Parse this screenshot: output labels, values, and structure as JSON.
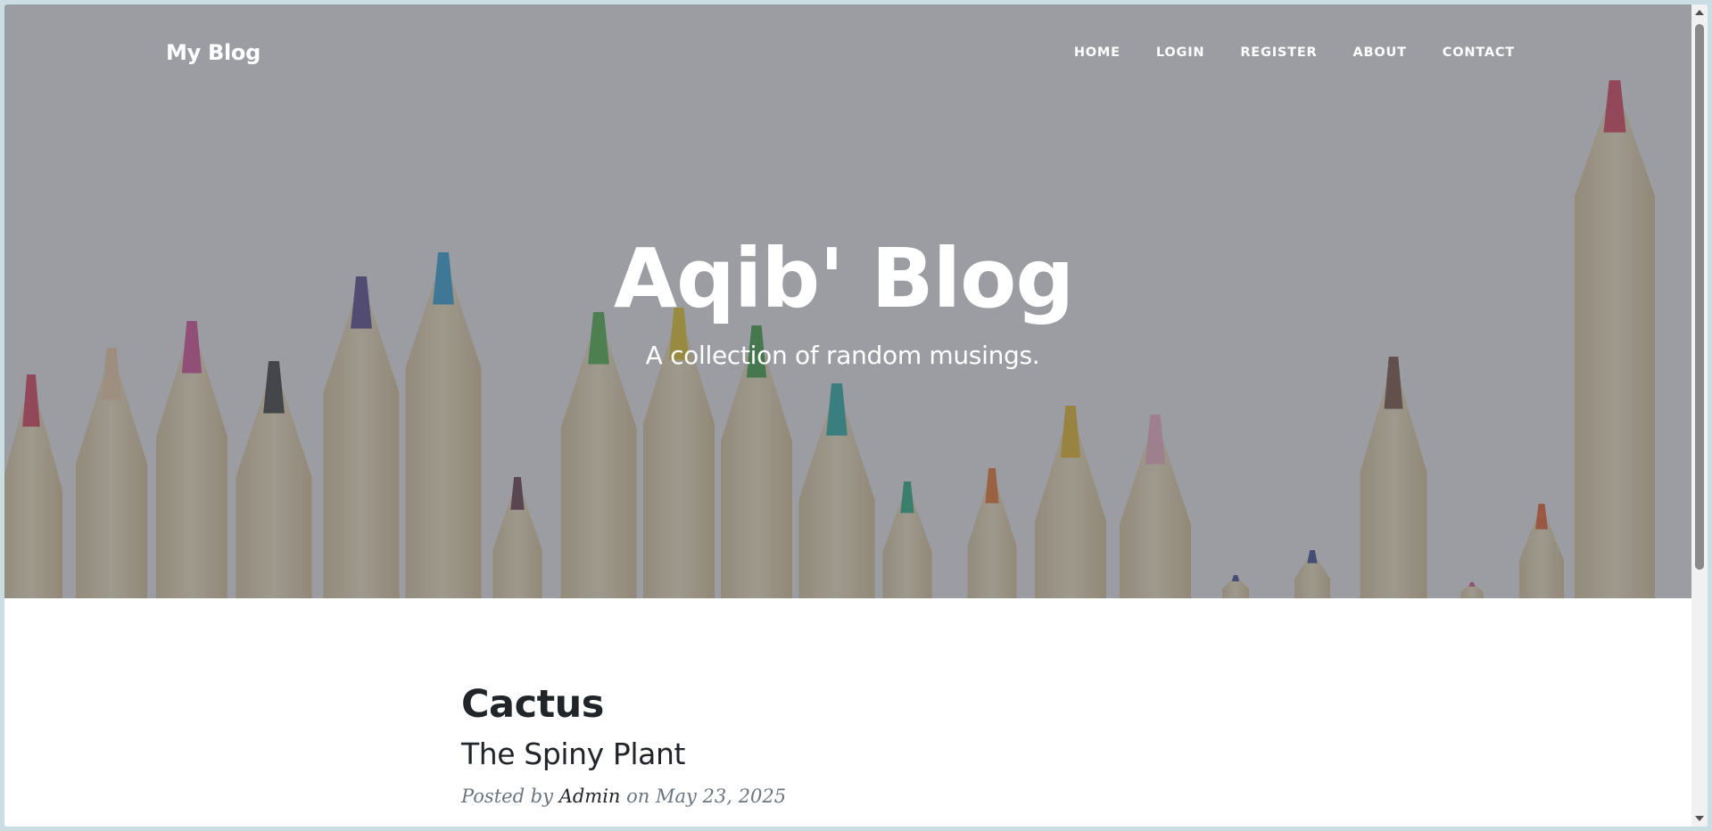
{
  "navbar": {
    "brand": "My Blog",
    "links": [
      "HOME",
      "LOGIN",
      "REGISTER",
      "ABOUT",
      "CONTACT"
    ]
  },
  "hero": {
    "title": "Aqib' Blog",
    "subtitle": "A collection of random musings."
  },
  "post": {
    "title": "Cactus",
    "subtitle": "The Spiny Plant",
    "meta_prefix": "Posted by",
    "author": "Admin",
    "meta_on": "on",
    "date": "May 23, 2025"
  },
  "colors": {
    "overlay": "#5a5c62",
    "heading_text": "#212529",
    "meta_text": "#6c757d"
  }
}
